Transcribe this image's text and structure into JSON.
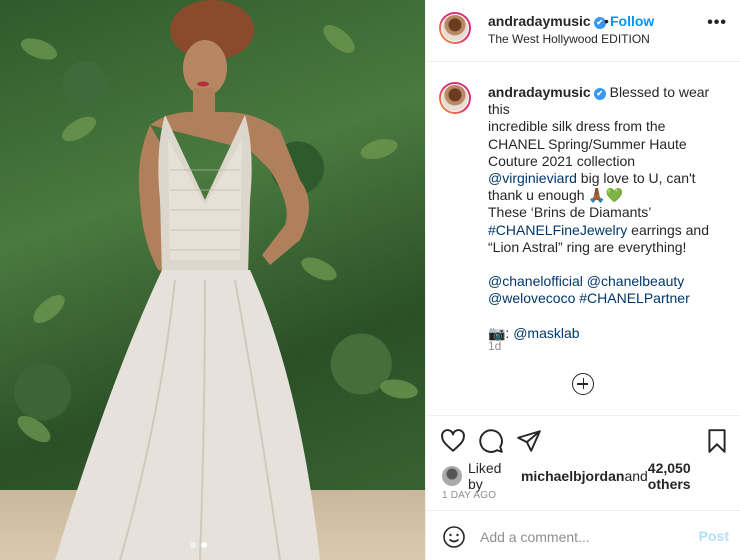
{
  "post": {
    "username": "andradaymusic",
    "follow_label": "Follow",
    "separator": "•",
    "location": "The West Hollywood EDITION",
    "more_label": "•••"
  },
  "caption": {
    "username": "andradaymusic",
    "lines": [
      "Blessed to wear this",
      "incredible silk dress from the",
      "CHANEL Spring/Summer Haute",
      "Couture 2021 collection",
      "@virginieviard",
      " big love to U, can't",
      "thank u enough 🙏🏾💚",
      "These ‘Brins de Diamants’",
      "#CHANELFineJewelry",
      " earrings and",
      "“Lion Astral” ring are everything!",
      "@chanelofficial",
      "@chanelbeauty",
      "@welovecoco",
      "#CHANELPartner",
      "📷: ",
      "@masklab"
    ],
    "age": "1d"
  },
  "likes": {
    "prefix": "Liked by ",
    "user": "michaelbjordan",
    "middle": " and ",
    "count": "42,050 others"
  },
  "date": "1 DAY AGO",
  "comment_box": {
    "placeholder": "Add a comment...",
    "post_label": "Post"
  },
  "colors": {
    "link": "#00376b",
    "follow": "#0095f6",
    "muted": "#8e8e8e",
    "post_disabled": "#b2dffc"
  },
  "icons": [
    "verified-badge-icon",
    "more-options-icon",
    "heart-icon",
    "comment-icon",
    "share-icon",
    "bookmark-icon",
    "add-circle-icon",
    "emoji-icon"
  ],
  "carousel": {
    "count": 2,
    "active_index": 1
  }
}
